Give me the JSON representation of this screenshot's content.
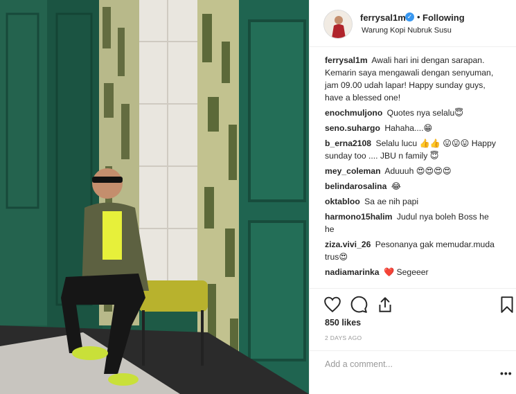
{
  "post": {
    "image_alt": "",
    "header": {
      "username": "ferrysal1m",
      "verified_glyph": "✓",
      "separator": "•",
      "follow_label": "Following",
      "location": "Warung Kopi Nubruk Susu"
    },
    "caption": {
      "username": "ferrysal1m",
      "text": "Awali hari ini dengan sarapan. Kemarin saya mengawali dengan senyuman, jam 09.00 udah lapar! Happy sunday guys, have a blessed one!"
    },
    "comments": [
      {
        "username": "enochmuljono",
        "text": "Quotes nya selalu😇"
      },
      {
        "username": "seno.suhargo",
        "text": "Hahaha....😁"
      },
      {
        "username": "b_erna2108",
        "text": "Selalu lucu 👍👍 😛😛😛 Happy sunday too .... JBU n family 😇"
      },
      {
        "username": "mey_coleman",
        "text": "Aduuuh 😍😍😍😍"
      },
      {
        "username": "belindarosalina",
        "text": "😂"
      },
      {
        "username": "oktabloo",
        "text": "Sa ae nih papi"
      },
      {
        "username": "harmono15halim",
        "text": "Judul nya boleh Boss he he"
      },
      {
        "username": "ziza.vivi_26",
        "text": "Pesonanya gak memudar.muda trus😍"
      },
      {
        "username": "nadiamarinka",
        "text": "❤️ Segeeer"
      }
    ],
    "likes": "850 likes",
    "timestamp": "2 DAYS AGO",
    "add_comment_placeholder": "Add a comment...",
    "more_options": "•••",
    "icons": {
      "like": "heart-icon",
      "comment": "speech-bubble-icon",
      "share": "share-arrow-icon",
      "save": "bookmark-icon"
    }
  }
}
